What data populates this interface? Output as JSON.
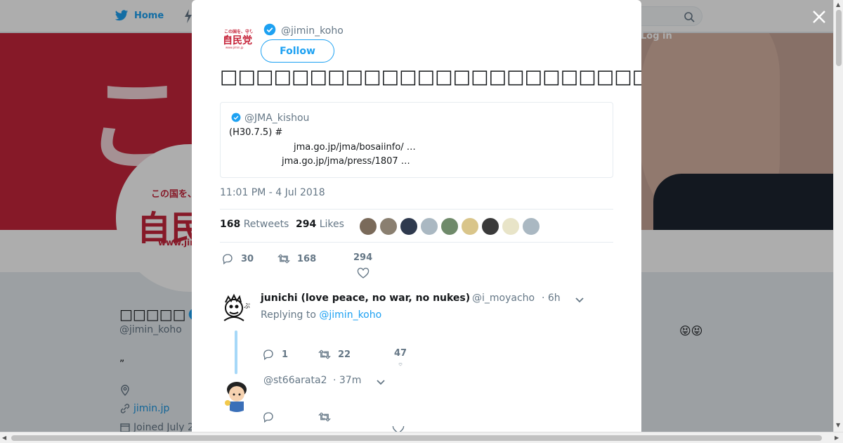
{
  "topbar": {
    "home_label": "Home",
    "login_label": "Log in"
  },
  "background_profile": {
    "name": "□□□□□",
    "handle": "@jimin_koho",
    "bio_quote": "”",
    "website": "jimin.jp",
    "joined": "Joined July 2",
    "banner_glyph": "この",
    "avatar_text_small": "この国を、守り抜く",
    "avatar_text_big": "自民党",
    "avatar_text_url": "www.jimin.jp",
    "emoji": "😝😝"
  },
  "tweet": {
    "author_handle": "@jimin_koho",
    "follow_label": "Follow",
    "text": "□□□□□□□□□□□□□□□□□□□□□□□□□□□□□□□□□□□□□□□ ",
    "hashtags": [
      "#□□",
      "#□□"
    ],
    "quoted": {
      "handle": "@JMA_kishou",
      "lines": [
        "(H30.7.5)                                                      #",
        "jma.go.jp/jma/bosaiinfo/                       …",
        "jma.go.jp/jma/press/1807                              …"
      ]
    },
    "timestamp": "11:01 PM - 4 Jul 2018",
    "retweets_count": "168",
    "retweets_label": "Retweets",
    "likes_count": "294",
    "likes_label": "Likes",
    "actions": {
      "reply": "30",
      "retweet": "168",
      "like": "294"
    }
  },
  "likers": [
    {
      "color": "#7a6a5a"
    },
    {
      "color": "#8a7f70"
    },
    {
      "color": "#2f3a4e"
    },
    {
      "color": "#aab8c2"
    },
    {
      "color": "#6f8a6a"
    },
    {
      "color": "#d9c58a"
    },
    {
      "color": "#3a3a3a"
    },
    {
      "color": "#e8e4c8"
    },
    {
      "color": "#aab8c2"
    }
  ],
  "replies": [
    {
      "name": "junichi (love peace, no war, no nukes)",
      "handle": "@i_moyacho",
      "time": "· 6h",
      "replying_prefix": "Replying to ",
      "replying_to": "@jimin_koho",
      "reply_count": "1",
      "retweet_count": "22",
      "like_count": "47"
    },
    {
      "name": "",
      "handle": "@st66arata2",
      "time": "· 37m",
      "reply_count": "",
      "retweet_count": "",
      "like_count": ""
    }
  ],
  "colors": {
    "twitter_blue": "#1da1f2",
    "brand_red": "#c6253b",
    "muted_text": "#657786"
  }
}
